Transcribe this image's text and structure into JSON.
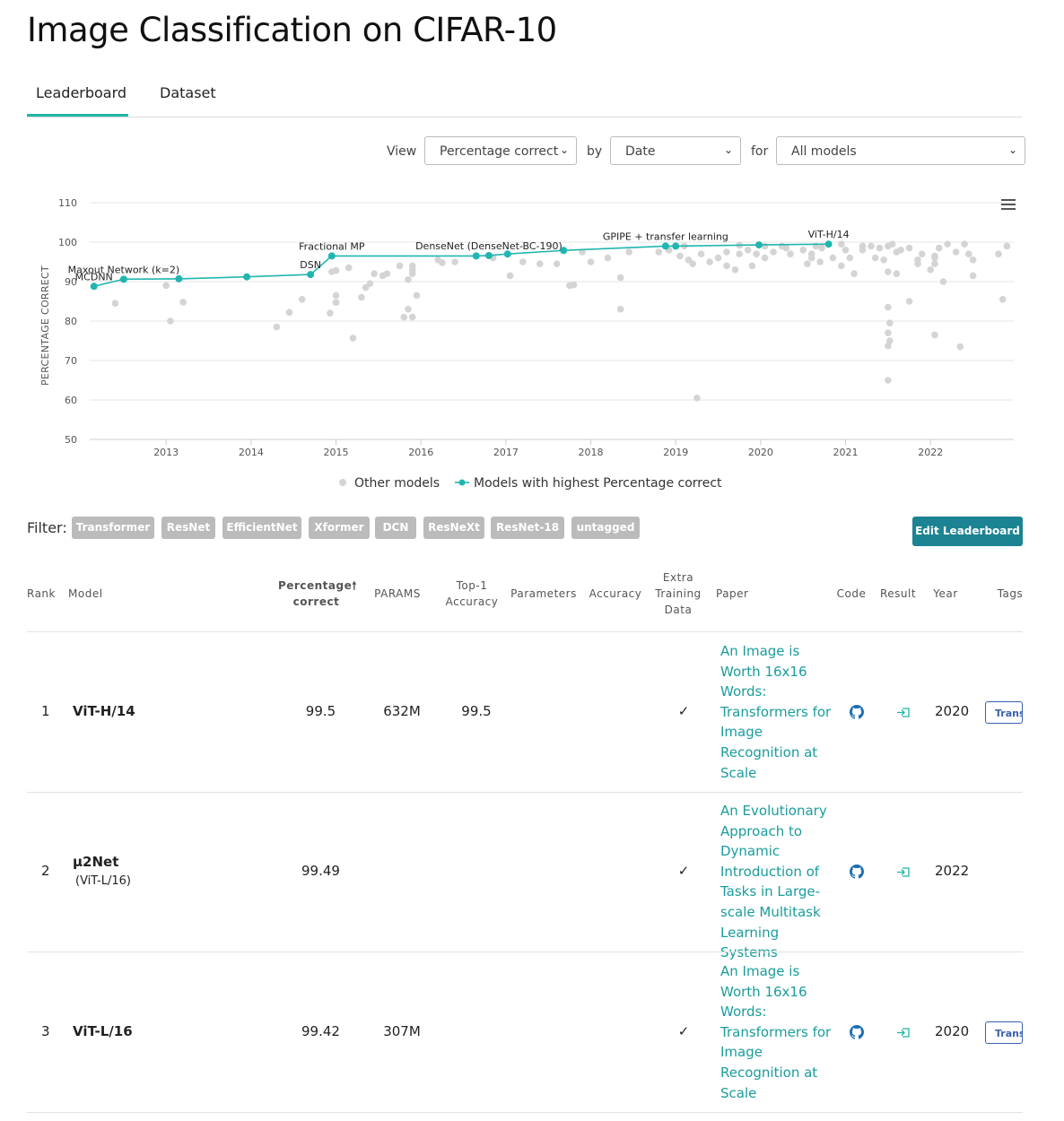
{
  "page": {
    "title": "Image Classification on CIFAR-10"
  },
  "tabs": [
    {
      "label": "Leaderboard",
      "active": true
    },
    {
      "label": "Dataset",
      "active": false
    }
  ],
  "controls": {
    "view_label": "View",
    "view_value": "Percentage correct",
    "by_label": "by",
    "by_value": "Date",
    "for_label": "for",
    "for_value": "All models"
  },
  "chart_data": {
    "type": "scatter",
    "ylabel": "PERCENTAGE CORRECT",
    "ylim": [
      50,
      110
    ],
    "yticks": [
      50,
      60,
      70,
      80,
      90,
      100,
      110
    ],
    "xticks": [
      "2013",
      "2014",
      "2015",
      "2016",
      "2017",
      "2018",
      "2019",
      "2020",
      "2021",
      "2022"
    ],
    "xlim": [
      2012.1,
      2022.98
    ],
    "grid": true,
    "legend": {
      "position": "bottom",
      "other": "Other models",
      "best": "Models with highest Percentage correct"
    },
    "colors": {
      "best": "#21b5b0",
      "other": "#d4d4d4"
    },
    "best_series": [
      {
        "x": 2012.15,
        "y": 88.8,
        "label": "MCDNN"
      },
      {
        "x": 2012.5,
        "y": 90.6,
        "label": "Maxout Network (k=2)"
      },
      {
        "x": 2013.15,
        "y": 90.7,
        "label": ""
      },
      {
        "x": 2013.95,
        "y": 91.2,
        "label": ""
      },
      {
        "x": 2014.7,
        "y": 91.8,
        "label": "DSN"
      },
      {
        "x": 2014.95,
        "y": 96.5,
        "label": "Fractional MP"
      },
      {
        "x": 2016.65,
        "y": 96.5,
        "label": ""
      },
      {
        "x": 2016.8,
        "y": 96.6,
        "label": "DenseNet (DenseNet-BC-190)"
      },
      {
        "x": 2017.02,
        "y": 97.0,
        "label": ""
      },
      {
        "x": 2017.68,
        "y": 97.9,
        "label": ""
      },
      {
        "x": 2018.88,
        "y": 99.0,
        "label": "GPIPE + transfer learning"
      },
      {
        "x": 2019.0,
        "y": 99.0,
        "label": ""
      },
      {
        "x": 2019.98,
        "y": 99.3,
        "label": ""
      },
      {
        "x": 2020.8,
        "y": 99.5,
        "label": "ViT-H/14"
      }
    ],
    "other_points": [
      [
        2012.4,
        84.5
      ],
      [
        2013.0,
        89
      ],
      [
        2013.05,
        80
      ],
      [
        2013.2,
        84.8
      ],
      [
        2014.3,
        78.5
      ],
      [
        2014.45,
        82.2
      ],
      [
        2014.6,
        85.5
      ],
      [
        2014.93,
        82
      ],
      [
        2014.95,
        92.5
      ],
      [
        2015.0,
        92.8
      ],
      [
        2015.0,
        86.5
      ],
      [
        2015.0,
        84.7
      ],
      [
        2015.15,
        93.5
      ],
      [
        2015.2,
        75.7
      ],
      [
        2015.3,
        86
      ],
      [
        2015.35,
        88.5
      ],
      [
        2015.4,
        89.5
      ],
      [
        2015.45,
        92
      ],
      [
        2015.55,
        91.5
      ],
      [
        2015.6,
        92
      ],
      [
        2015.75,
        94
      ],
      [
        2015.8,
        81
      ],
      [
        2015.85,
        83
      ],
      [
        2015.9,
        81
      ],
      [
        2015.9,
        93
      ],
      [
        2015.9,
        92
      ],
      [
        2015.85,
        90.5
      ],
      [
        2015.9,
        94
      ],
      [
        2015.95,
        86.5
      ],
      [
        2016.2,
        95.5
      ],
      [
        2016.25,
        94.8
      ],
      [
        2016.4,
        95
      ],
      [
        2016.85,
        96
      ],
      [
        2017.05,
        91.5
      ],
      [
        2017.2,
        95
      ],
      [
        2017.4,
        94.5
      ],
      [
        2017.6,
        94.5
      ],
      [
        2017.75,
        89
      ],
      [
        2017.8,
        89.2
      ],
      [
        2017.9,
        97.5
      ],
      [
        2018.0,
        95
      ],
      [
        2018.2,
        96
      ],
      [
        2018.35,
        91
      ],
      [
        2018.35,
        83
      ],
      [
        2018.45,
        97.5
      ],
      [
        2018.8,
        97.5
      ],
      [
        2018.92,
        98
      ],
      [
        2019.05,
        96.5
      ],
      [
        2019.1,
        99
      ],
      [
        2019.15,
        95.5
      ],
      [
        2019.2,
        94.5
      ],
      [
        2019.25,
        60.5
      ],
      [
        2019.3,
        97
      ],
      [
        2019.4,
        95
      ],
      [
        2019.5,
        96
      ],
      [
        2019.6,
        94
      ],
      [
        2019.6,
        97.5
      ],
      [
        2019.7,
        93
      ],
      [
        2019.75,
        97
      ],
      [
        2019.75,
        99.2
      ],
      [
        2019.85,
        98
      ],
      [
        2019.95,
        97
      ],
      [
        2019.9,
        94
      ],
      [
        2020.05,
        96
      ],
      [
        2020.05,
        99
      ],
      [
        2020.15,
        97.5
      ],
      [
        2020.25,
        99
      ],
      [
        2020.3,
        98.5
      ],
      [
        2020.35,
        97
      ],
      [
        2020.5,
        98
      ],
      [
        2020.55,
        94.5
      ],
      [
        2020.6,
        97
      ],
      [
        2020.6,
        96
      ],
      [
        2020.65,
        99
      ],
      [
        2020.7,
        95
      ],
      [
        2020.72,
        98.5
      ],
      [
        2020.85,
        96
      ],
      [
        2020.95,
        99.5
      ],
      [
        2020.95,
        94
      ],
      [
        2021.0,
        98
      ],
      [
        2021.05,
        96
      ],
      [
        2021.1,
        92
      ],
      [
        2021.2,
        99
      ],
      [
        2021.2,
        98
      ],
      [
        2021.3,
        99
      ],
      [
        2021.35,
        96
      ],
      [
        2021.4,
        98.5
      ],
      [
        2021.45,
        95.5
      ],
      [
        2021.5,
        92.5
      ],
      [
        2021.55,
        99.5
      ],
      [
        2021.6,
        92
      ],
      [
        2021.6,
        97.5
      ],
      [
        2021.65,
        98
      ],
      [
        2021.5,
        99
      ],
      [
        2021.5,
        83.5
      ],
      [
        2021.52,
        79.5
      ],
      [
        2021.5,
        77
      ],
      [
        2021.52,
        75
      ],
      [
        2021.5,
        73.7
      ],
      [
        2021.5,
        65
      ],
      [
        2021.75,
        98.5
      ],
      [
        2021.75,
        85
      ],
      [
        2021.85,
        94.5
      ],
      [
        2021.9,
        97
      ],
      [
        2021.85,
        95.5
      ],
      [
        2022.0,
        93
      ],
      [
        2022.05,
        96.5
      ],
      [
        2022.05,
        94.5
      ],
      [
        2022.1,
        98.5
      ],
      [
        2022.15,
        90
      ],
      [
        2022.05,
        76.5
      ],
      [
        2022.2,
        99.5
      ],
      [
        2022.4,
        99.5
      ],
      [
        2022.35,
        73.5
      ],
      [
        2022.45,
        97
      ],
      [
        2022.5,
        95.5
      ],
      [
        2022.5,
        91.5
      ],
      [
        2022.8,
        97
      ],
      [
        2022.85,
        85.5
      ],
      [
        2022.9,
        99
      ],
      [
        2022.3,
        97.5
      ],
      [
        2022.05,
        96
      ]
    ]
  },
  "filter": {
    "label": "Filter:",
    "tags": [
      "Transformer",
      "ResNet",
      "EfficientNet",
      "Xformer",
      "DCN",
      "ResNeXt",
      "ResNet-18",
      "untagged"
    ],
    "edit_button": "Edit Leaderboard"
  },
  "table": {
    "headers": {
      "rank": "Rank",
      "model": "Model",
      "pct1": "Percentage",
      "pct2": "correct",
      "params": "PARAMS",
      "top1a": "Top-1",
      "top1b": "Accuracy",
      "parameters": "Parameters",
      "accuracy": "Accuracy",
      "extra1": "Extra",
      "extra2": "Training",
      "extra3": "Data",
      "paper": "Paper",
      "code": "Code",
      "result": "Result",
      "year": "Year",
      "tags": "Tags"
    },
    "rows": [
      {
        "rank": "1",
        "model": "ViT-H/14",
        "sub": "",
        "pct": "99.5",
        "params": "632M",
        "top1": "99.5",
        "extra": "✓",
        "paper": "An Image is Worth 16x16 Words: Transformers for Image Recognition at Scale",
        "year": "2020",
        "tag": "Transformer"
      },
      {
        "rank": "2",
        "model": "µ2Net",
        "sub": "(ViT-L/16)",
        "pct": "99.49",
        "params": "",
        "top1": "",
        "extra": "✓",
        "paper": "An Evolutionary Approach to Dynamic Introduction of Tasks in Large-scale Multitask Learning Systems",
        "year": "2022",
        "tag": ""
      },
      {
        "rank": "3",
        "model": "ViT-L/16",
        "sub": "",
        "pct": "99.42",
        "params": "307M",
        "top1": "",
        "extra": "✓",
        "paper": "An Image is Worth 16x16 Words: Transformers for Image Recognition at Scale",
        "year": "2020",
        "tag": "Transformer"
      }
    ]
  }
}
